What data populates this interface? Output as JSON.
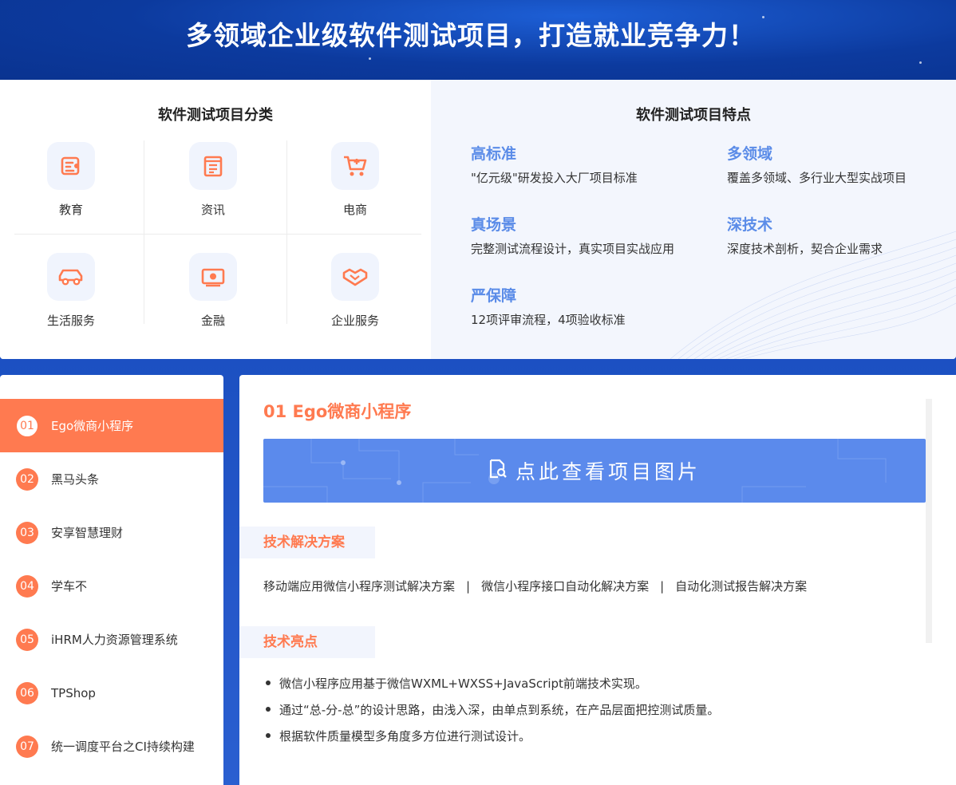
{
  "hero": {
    "title": "多领域企业级软件测试项目，打造就业竞争力！"
  },
  "categories": {
    "heading": "软件测试项目分类",
    "items": [
      {
        "label": "教育",
        "icon": "education-icon"
      },
      {
        "label": "资讯",
        "icon": "news-icon"
      },
      {
        "label": "电商",
        "icon": "cart-icon"
      },
      {
        "label": "生活服务",
        "icon": "car-icon"
      },
      {
        "label": "金融",
        "icon": "money-icon"
      },
      {
        "label": "企业服务",
        "icon": "handshake-icon"
      }
    ]
  },
  "features": {
    "heading": "软件测试项目特点",
    "items": [
      {
        "title": "高标准",
        "desc": "\"亿元级\"研发投入大厂项目标准"
      },
      {
        "title": "多领域",
        "desc": "覆盖多领域、多行业大型实战项目"
      },
      {
        "title": "真场景",
        "desc": "完整测试流程设计，真实项目实战应用"
      },
      {
        "title": "深技术",
        "desc": "深度技术剖析，契合企业需求"
      },
      {
        "title": "严保障",
        "desc": "12项评审流程，4项验收标准"
      }
    ]
  },
  "projects": [
    {
      "num": "01",
      "name": "Ego微商小程序",
      "active": true
    },
    {
      "num": "02",
      "name": "黑马头条"
    },
    {
      "num": "03",
      "name": "安享智慧理财"
    },
    {
      "num": "04",
      "name": "学车不"
    },
    {
      "num": "05",
      "name": "iHRM人力资源管理系统"
    },
    {
      "num": "06",
      "name": "TPShop"
    },
    {
      "num": "07",
      "name": "统一调度平台之CI持续构建"
    }
  ],
  "detail": {
    "title": "01 Ego微商小程序",
    "view_button": "点此查看项目图片",
    "solutions_heading": "技术解决方案",
    "solutions": [
      "移动端应用微信小程序测试解决方案",
      "微信小程序接口自动化解决方案",
      "自动化测试报告解决方案"
    ],
    "separator": "|",
    "highlights_heading": "技术亮点",
    "highlights": [
      "微信小程序应用基于微信WXML+WXSS+JavaScript前端技术实现。",
      "通过“总-分-总”的设计思路，由浅入深，由单点到系统，在产品层面把控测试质量。",
      "根据软件质量模型多角度多方位进行测试设计。"
    ]
  },
  "colors": {
    "accent": "#ff7a50",
    "feature_blue": "#5b8ce8",
    "banner_blue": "#5b8aec",
    "bg_blue": "#1a4fc0"
  }
}
